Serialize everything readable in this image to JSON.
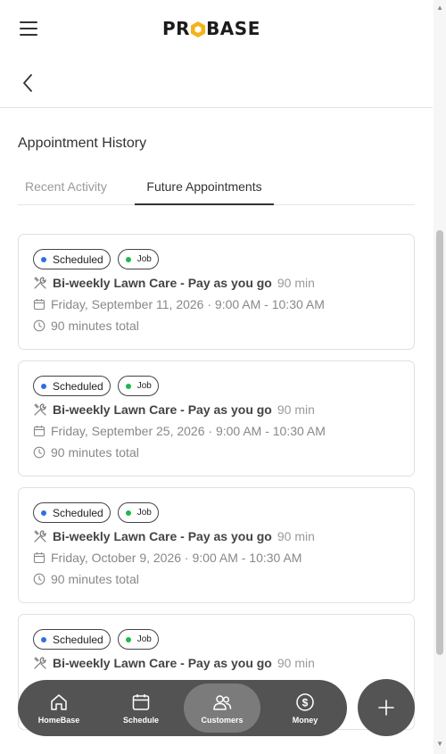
{
  "header": {
    "menu_icon": "hamburger-menu-icon",
    "logo_text_a": "PR",
    "logo_text_b": "BASE",
    "logo_accent": "#f5b21b"
  },
  "nav": {
    "back_icon": "chevron-left-icon"
  },
  "page": {
    "title": "Appointment History"
  },
  "tabs": [
    {
      "label": "Recent Activity",
      "active": false
    },
    {
      "label": "Future Appointments",
      "active": true
    }
  ],
  "appointments": [
    {
      "status": "Scheduled",
      "status_color": "#2f6fe0",
      "type": "Job",
      "type_color": "#1fb84a",
      "service": "Bi-weekly Lawn Care - Pay as you go",
      "duration": "90 min",
      "date": "Friday, September 11, 2026",
      "time": "9:00 AM - 10:30 AM",
      "total": "90 minutes total"
    },
    {
      "status": "Scheduled",
      "status_color": "#2f6fe0",
      "type": "Job",
      "type_color": "#1fb84a",
      "service": "Bi-weekly Lawn Care - Pay as you go",
      "duration": "90 min",
      "date": "Friday, September 25, 2026",
      "time": "9:00 AM - 10:30 AM",
      "total": "90 minutes total"
    },
    {
      "status": "Scheduled",
      "status_color": "#2f6fe0",
      "type": "Job",
      "type_color": "#1fb84a",
      "service": "Bi-weekly Lawn Care - Pay as you go",
      "duration": "90 min",
      "date": "Friday, October 9, 2026",
      "time": "9:00 AM - 10:30 AM",
      "total": "90 minutes total"
    },
    {
      "status": "Scheduled",
      "status_color": "#2f6fe0",
      "type": "Job",
      "type_color": "#1fb84a",
      "service": "Bi-weekly Lawn Care - Pay as you go",
      "duration": "90 min",
      "date": "",
      "time": "",
      "total": ""
    }
  ],
  "bottom_nav": [
    {
      "label": "HomeBase",
      "icon": "home-icon",
      "active": false
    },
    {
      "label": "Schedule",
      "icon": "calendar-icon",
      "active": false
    },
    {
      "label": "Customers",
      "icon": "users-icon",
      "active": true
    },
    {
      "label": "Money",
      "icon": "dollar-icon",
      "active": false
    }
  ],
  "fab": {
    "icon": "plus-icon"
  }
}
